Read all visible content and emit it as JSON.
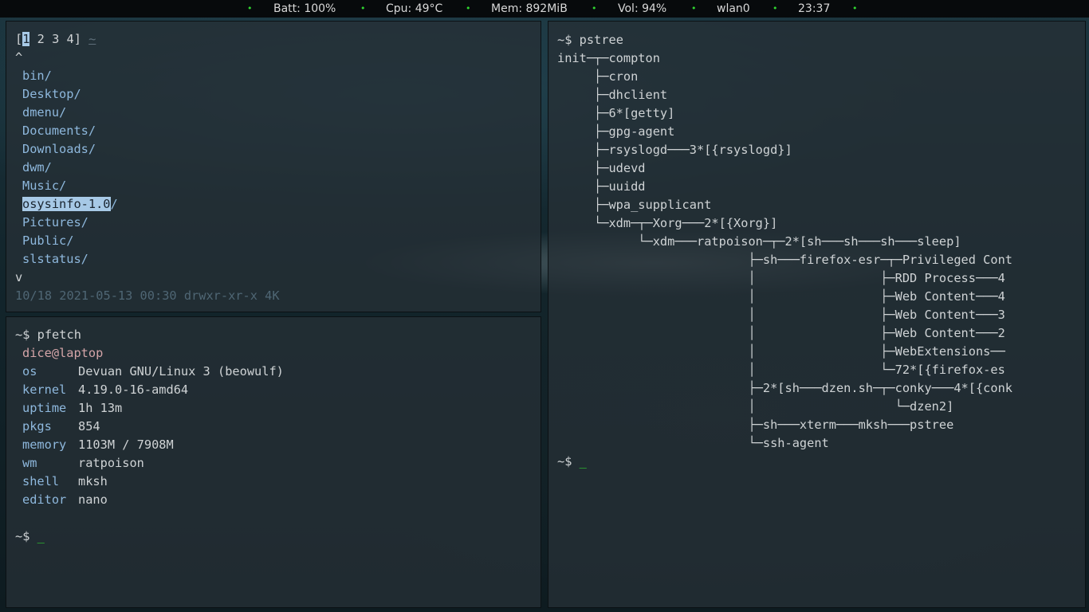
{
  "statusbar": {
    "batt": "Batt: 100%",
    "cpu": "Cpu: 49°C",
    "mem": "Mem: 892MiB",
    "vol": "Vol: 94%",
    "net": "wlan0",
    "clock": "23:37",
    "dot": "•"
  },
  "filemanager": {
    "tab_open": "[",
    "tab_active": "1",
    "tabs_rest": " 2 3 4]",
    "tab_path": "~",
    "up_marker": "^",
    "down_marker": "v",
    "entries": [
      "bin/",
      "Desktop/",
      "dmenu/",
      "Documents/",
      "Downloads/",
      "dwm/",
      "Music/",
      "osysinfo-1.0",
      "Pictures/",
      "Public/",
      "slstatus/"
    ],
    "selected_suffix": "/",
    "status_line": "10/18 2021-05-13 00:30 drwxr-xr-x 4K"
  },
  "pfetch": {
    "prompt": "~$",
    "command": "pfetch",
    "userhost": "dice@laptop",
    "rows": [
      {
        "key": "os",
        "value": "Devuan GNU/Linux 3 (beowulf)"
      },
      {
        "key": "kernel",
        "value": "4.19.0-16-amd64"
      },
      {
        "key": "uptime",
        "value": "1h 13m"
      },
      {
        "key": "pkgs",
        "value": "854"
      },
      {
        "key": "memory",
        "value": "1103M / 7908M"
      },
      {
        "key": "wm",
        "value": "ratpoison"
      },
      {
        "key": "shell",
        "value": "mksh"
      },
      {
        "key": "editor",
        "value": "nano"
      }
    ],
    "final_prompt": "~$",
    "cursor": "_"
  },
  "pstree": {
    "prompt": "~$",
    "command": "pstree",
    "lines": [
      "init─┬─compton",
      "     ├─cron",
      "     ├─dhclient",
      "     ├─6*[getty]",
      "     ├─gpg-agent",
      "     ├─rsyslogd───3*[{rsyslogd}]",
      "     ├─udevd",
      "     ├─uuidd",
      "     ├─wpa_supplicant",
      "     └─xdm─┬─Xorg───2*[{Xorg}]",
      "           └─xdm───ratpoison─┬─2*[sh───sh───sh───sleep]",
      "                          ├─sh───firefox-esr─┬─Privileged Cont",
      "                          │                 ├─RDD Process───4",
      "                          │                 ├─Web Content───4",
      "                          │                 ├─Web Content───3",
      "                          │                 ├─Web Content───2",
      "                          │                 ├─WebExtensions──",
      "                          │                 └─72*[{firefox-es",
      "                          ├─2*[sh───dzen.sh─┬─conky───4*[{conk",
      "                          │                   └─dzen2]",
      "                          ├─sh───xterm───mksh───pstree",
      "                          └─ssh-agent"
    ],
    "final_prompt": "~$",
    "cursor": "_"
  }
}
